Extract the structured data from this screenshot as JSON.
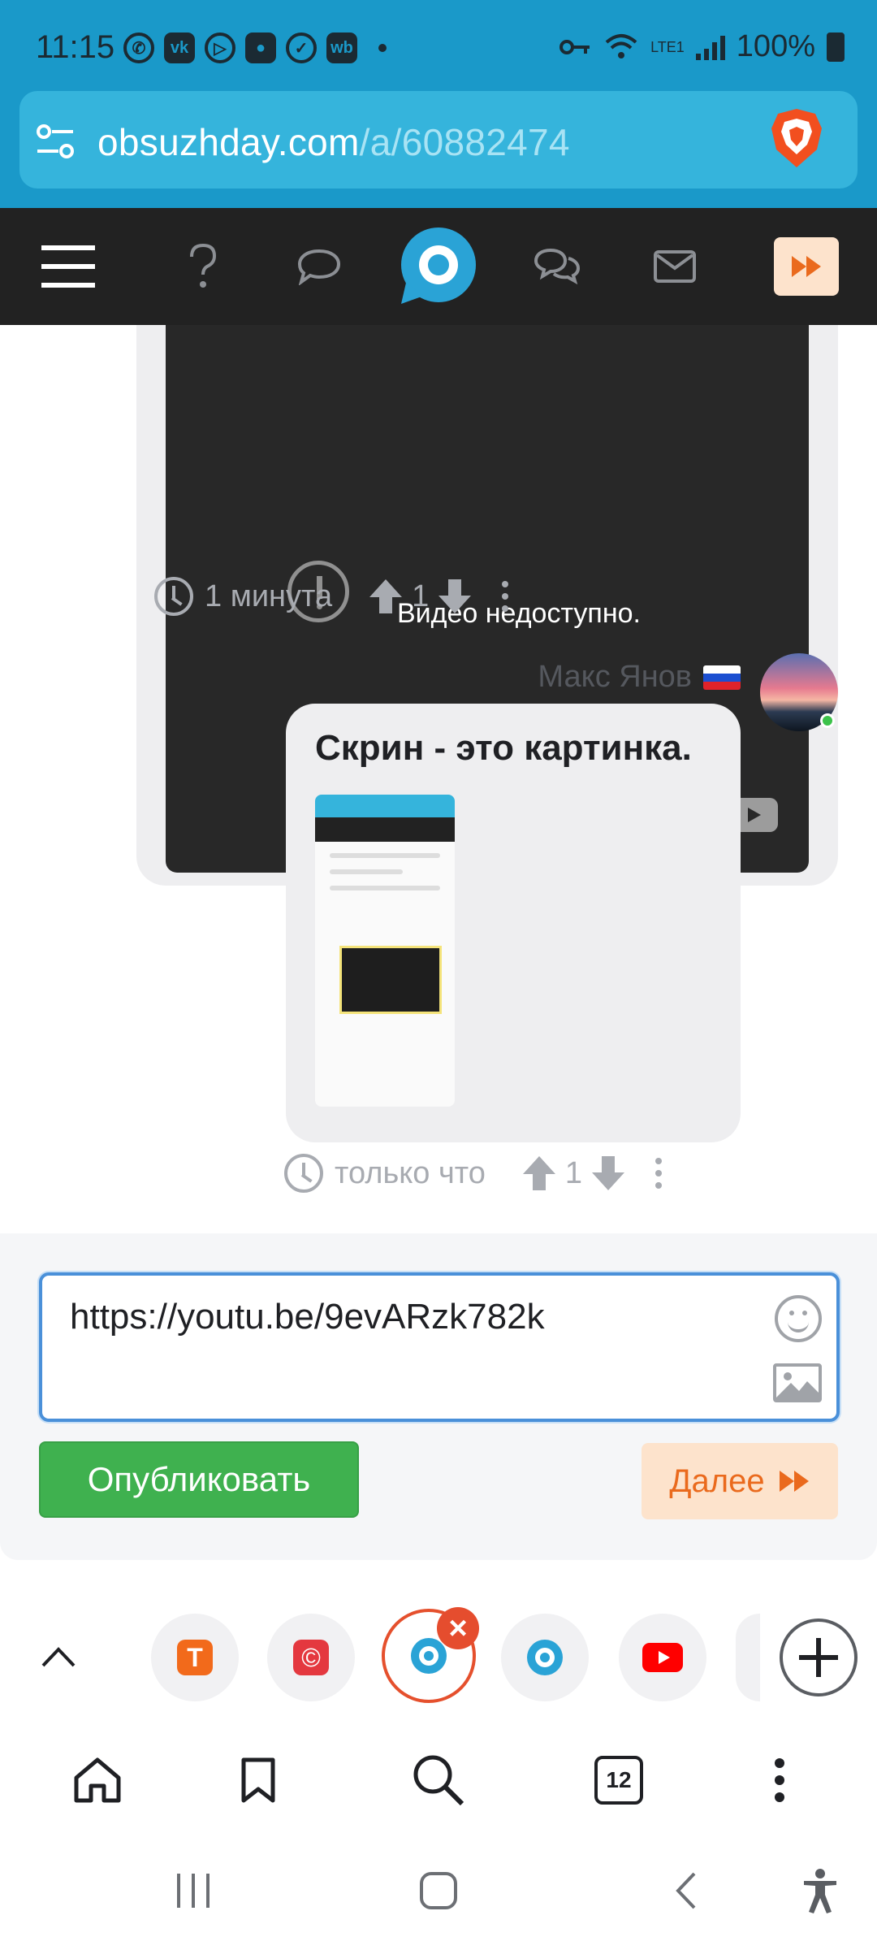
{
  "status_bar": {
    "time": "11:15",
    "battery": "100%",
    "network": "LTE1",
    "app_icons": [
      "whatsapp-icon",
      "vk-icon",
      "play-icon",
      "contacts-icon",
      "check-icon",
      "wb-icon"
    ]
  },
  "browser": {
    "url_domain": "obsuzhday.com",
    "url_path": "/a/60882474"
  },
  "post1": {
    "video_message": "Видео недоступно.",
    "time": "1 минута",
    "votes": "1"
  },
  "post2": {
    "author": "Макс Янов",
    "text": "Скрин - это картинка.",
    "time": "только что",
    "votes": "1"
  },
  "form": {
    "input_value": "https://youtu.be/9evARzk782k",
    "publish_label": "Опубликовать",
    "next_label": "Далее"
  },
  "tabs": {
    "count": "12"
  },
  "colors": {
    "brand_blue": "#1a99c9",
    "nav_dark": "#222222",
    "publish_green": "#3fb14f",
    "accent_orange": "#ea6a1d"
  }
}
